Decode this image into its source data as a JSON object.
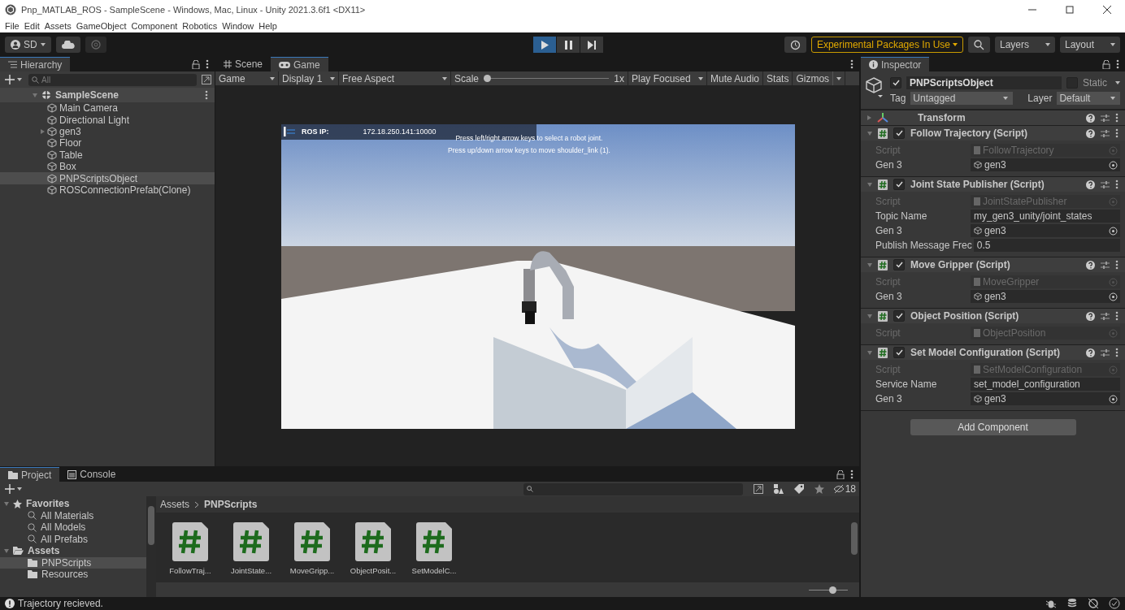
{
  "window": {
    "title": "Pnp_MATLAB_ROS - SampleScene - Windows, Mac, Linux - Unity 2021.3.6f1 <DX11>"
  },
  "menu": [
    "File",
    "Edit",
    "Assets",
    "GameObject",
    "Component",
    "Robotics",
    "Window",
    "Help"
  ],
  "toolbar": {
    "account": "SD",
    "play": {
      "selected": true
    },
    "pause": {
      "selected": false
    },
    "step": {
      "selected": false
    },
    "experimental": "Experimental Packages In Use",
    "layers": "Layers",
    "layout": "Layout"
  },
  "hierarchy": {
    "tab": "Hierarchy",
    "search_placeholder": "All",
    "scene": "SampleScene",
    "items": [
      {
        "label": "Main Camera",
        "has_children": false,
        "selected": false
      },
      {
        "label": "Directional Light",
        "has_children": false,
        "selected": false
      },
      {
        "label": "gen3",
        "has_children": true,
        "selected": false
      },
      {
        "label": "Floor",
        "has_children": false,
        "selected": false
      },
      {
        "label": "Table",
        "has_children": false,
        "selected": false
      },
      {
        "label": "Box",
        "has_children": false,
        "selected": false
      },
      {
        "label": "PNPScriptsObject",
        "has_children": false,
        "selected": true
      },
      {
        "label": "ROSConnectionPrefab(Clone)",
        "has_children": false,
        "selected": false
      }
    ]
  },
  "views": {
    "tabs": [
      {
        "label": "Scene",
        "selected": false,
        "kind": "scene"
      },
      {
        "label": "Game",
        "selected": true,
        "kind": "game"
      }
    ],
    "controls": {
      "mode": "Game",
      "display": "Display 1",
      "aspect": "Free Aspect",
      "scale_label": "Scale",
      "scale": {
        "level": 0
      },
      "scale_value": "1x",
      "play_focused": "Play Focused",
      "mute_audio": "Mute Audio",
      "stats": "Stats",
      "gizmos": "Gizmos"
    },
    "game_hud": {
      "ros_ip_label": "ROS IP:",
      "ros_ip": "172.18.250.141:10000",
      "instructions": [
        "Press left/right arrow keys to select a robot joint.",
        "Press up/down arrow keys to move shoulder_link (1)."
      ]
    }
  },
  "inspector": {
    "tab": "Inspector",
    "object": {
      "name": "PNPScriptsObject",
      "active": true,
      "static": false,
      "static_label": "Static",
      "tag_label": "Tag",
      "tag": "Untagged",
      "layer_label": "Layer",
      "layer": "Default"
    },
    "components": [
      {
        "name": "Transform",
        "kind": "transform",
        "expanded": false
      },
      {
        "name": "Follow Trajectory (Script)",
        "kind": "script",
        "expanded": true,
        "enabled": true,
        "fields": [
          {
            "label": "Script",
            "kind": "script",
            "value": "FollowTrajectory"
          },
          {
            "label": "Gen 3",
            "kind": "object",
            "value": "gen3"
          }
        ]
      },
      {
        "name": "Joint State Publisher (Script)",
        "kind": "script",
        "expanded": true,
        "enabled": true,
        "fields": [
          {
            "label": "Script",
            "kind": "script",
            "value": "JointStatePublisher"
          },
          {
            "label": "Topic Name",
            "kind": "text",
            "value": "my_gen3_unity/joint_states"
          },
          {
            "label": "Gen 3",
            "kind": "object",
            "value": "gen3"
          },
          {
            "label": "Publish Message Frec",
            "kind": "text",
            "value": "0.5"
          }
        ]
      },
      {
        "name": "Move Gripper (Script)",
        "kind": "script",
        "expanded": true,
        "enabled": true,
        "fields": [
          {
            "label": "Script",
            "kind": "script",
            "value": "MoveGripper"
          },
          {
            "label": "Gen 3",
            "kind": "object",
            "value": "gen3"
          }
        ]
      },
      {
        "name": "Object Position (Script)",
        "kind": "script",
        "expanded": true,
        "enabled": true,
        "fields": [
          {
            "label": "Script",
            "kind": "script",
            "value": "ObjectPosition"
          }
        ]
      },
      {
        "name": "Set Model Configuration (Script)",
        "kind": "script",
        "expanded": true,
        "enabled": true,
        "fields": [
          {
            "label": "Script",
            "kind": "script",
            "value": "SetModelConfiguration"
          },
          {
            "label": "Service Name",
            "kind": "text",
            "value": "set_model_configuration"
          },
          {
            "label": "Gen 3",
            "kind": "object",
            "value": "gen3"
          }
        ]
      }
    ],
    "add_component": "Add Component"
  },
  "project": {
    "tabs": [
      {
        "label": "Project",
        "selected": true,
        "kind": "project"
      },
      {
        "label": "Console",
        "selected": false,
        "kind": "console"
      }
    ],
    "tree": [
      {
        "label": "Favorites",
        "kind": "favorites",
        "expanded": true,
        "children": [
          {
            "label": "All Materials",
            "selected": false
          },
          {
            "label": "All Models",
            "selected": false
          },
          {
            "label": "All Prefabs",
            "selected": false
          }
        ]
      },
      {
        "label": "Assets",
        "kind": "folder",
        "expanded": true,
        "children": [
          {
            "label": "PNPScripts",
            "selected": true
          },
          {
            "label": "Resources",
            "selected": false
          }
        ]
      }
    ],
    "breadcrumb": [
      "Assets",
      "PNPScripts"
    ],
    "files": [
      {
        "label": "FollowTraj..."
      },
      {
        "label": "JointState..."
      },
      {
        "label": "MoveGripp..."
      },
      {
        "label": "ObjectPosit..."
      },
      {
        "label": "SetModelC..."
      }
    ],
    "hidden_count": "18",
    "zoom": {
      "level": 0.6
    }
  },
  "status_bar": {
    "message": "Trajectory recieved."
  }
}
